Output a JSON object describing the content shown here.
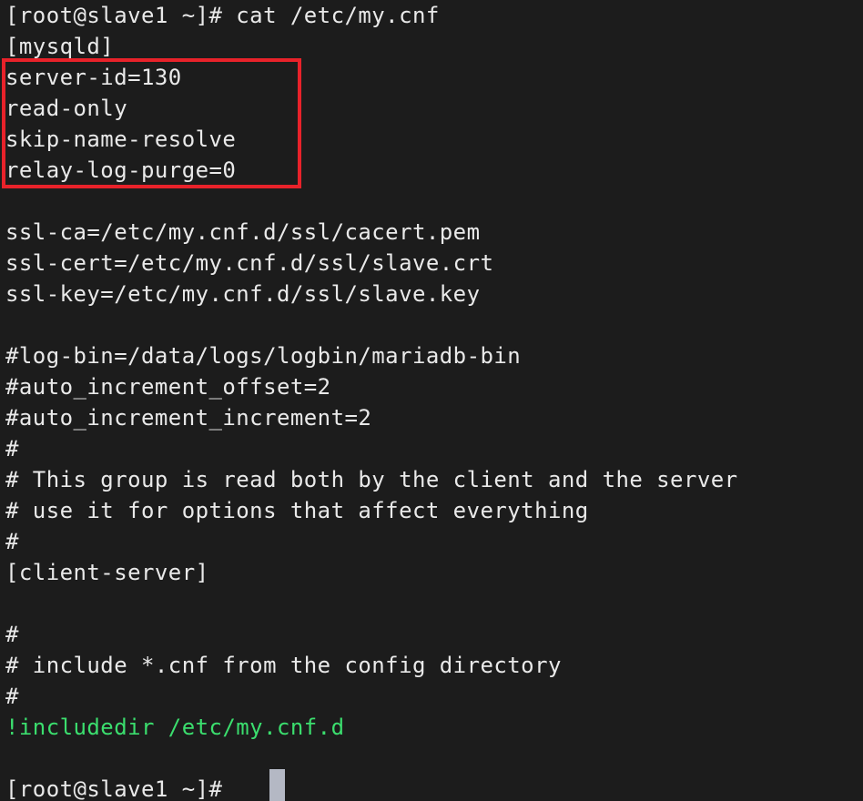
{
  "terminal": {
    "background_color": "#1c1c1c",
    "text_color": "#e9e9e9",
    "green_color": "#3bde6e",
    "highlight_box_color": "#e8222a",
    "cursor_color": "#b4b8c4",
    "prompt": "[root@slave1 ~]#",
    "command": "cat /etc/my.cnf",
    "lines": [
      {
        "text": "[root@slave1 ~]# cat /etc/my.cnf",
        "color": "default",
        "name": "prompt-command-line"
      },
      {
        "text": "[mysqld]",
        "color": "default",
        "name": "section-mysqld"
      },
      {
        "text": "server-id=130",
        "color": "default",
        "name": "directive-server-id"
      },
      {
        "text": "read-only",
        "color": "default",
        "name": "directive-read-only"
      },
      {
        "text": "skip-name-resolve",
        "color": "default",
        "name": "directive-skip-name-resolve"
      },
      {
        "text": "relay-log-purge=0",
        "color": "default",
        "name": "directive-relay-log-purge"
      },
      {
        "text": "",
        "color": "default",
        "name": "blank-line"
      },
      {
        "text": "ssl-ca=/etc/my.cnf.d/ssl/cacert.pem",
        "color": "default",
        "name": "directive-ssl-ca"
      },
      {
        "text": "ssl-cert=/etc/my.cnf.d/ssl/slave.crt",
        "color": "default",
        "name": "directive-ssl-cert"
      },
      {
        "text": "ssl-key=/etc/my.cnf.d/ssl/slave.key",
        "color": "default",
        "name": "directive-ssl-key"
      },
      {
        "text": "",
        "color": "default",
        "name": "blank-line"
      },
      {
        "text": "#log-bin=/data/logs/logbin/mariadb-bin",
        "color": "default",
        "name": "comment-log-bin"
      },
      {
        "text": "#auto_increment_offset=2",
        "color": "default",
        "name": "comment-auto-increment-offset"
      },
      {
        "text": "#auto_increment_increment=2",
        "color": "default",
        "name": "comment-auto-increment-increment"
      },
      {
        "text": "#",
        "color": "default",
        "name": "comment-separator"
      },
      {
        "text": "# This group is read both by the client and the server",
        "color": "default",
        "name": "comment-group-description"
      },
      {
        "text": "# use it for options that affect everything",
        "color": "default",
        "name": "comment-group-usage"
      },
      {
        "text": "#",
        "color": "default",
        "name": "comment-separator"
      },
      {
        "text": "[client-server]",
        "color": "default",
        "name": "section-client-server"
      },
      {
        "text": "",
        "color": "default",
        "name": "blank-line"
      },
      {
        "text": "#",
        "color": "default",
        "name": "comment-separator"
      },
      {
        "text": "# include *.cnf from the config directory",
        "color": "default",
        "name": "comment-includedir-description"
      },
      {
        "text": "#",
        "color": "default",
        "name": "comment-separator"
      },
      {
        "text": "!includedir /etc/my.cnf.d",
        "color": "green",
        "name": "directive-includedir"
      },
      {
        "text": "",
        "color": "default",
        "name": "blank-line"
      },
      {
        "text": "[root@slave1 ~]#",
        "color": "default",
        "name": "prompt-final-line"
      }
    ],
    "highlighted_directives": [
      "server-id=130",
      "read-only",
      "skip-name-resolve",
      "relay-log-purge=0"
    ]
  }
}
